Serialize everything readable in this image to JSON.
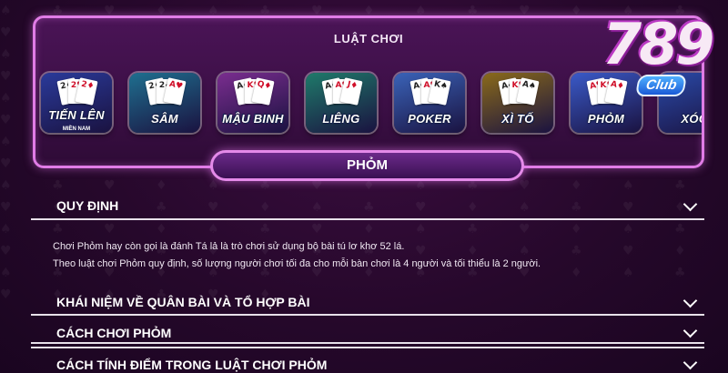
{
  "panel": {
    "title": "LUẬT CHƠI"
  },
  "games": [
    {
      "label": "TIẾN LÊN",
      "sub": "MIỀN NAM",
      "bg": "#2a3a9a",
      "c1": "2♠",
      "c2": "2♥",
      "c3": "2♦"
    },
    {
      "label": "SÂM",
      "bg": "#1f6f8f",
      "c1": "2♠",
      "c2": "2♣",
      "c3": "A♥"
    },
    {
      "label": "MẬU BINH",
      "bg": "#7a2d8f",
      "c1": "A♠",
      "c2": "K♥",
      "c3": "Q♦"
    },
    {
      "label": "LIÊNG",
      "bg": "#1f7a6a",
      "c1": "A♠",
      "c2": "A♥",
      "c3": "J♦"
    },
    {
      "label": "POKER",
      "bg": "#3a63b8",
      "c1": "A♠",
      "c2": "A♥",
      "c3": "K♠"
    },
    {
      "label": "XÌ TỐ",
      "bg": "#8a6a1a",
      "c1": "A♣",
      "c2": "K♥",
      "c3": "A♠"
    },
    {
      "label": "PHỎM",
      "bg": "#3a5ac8",
      "c1": "A♥",
      "c2": "K♥",
      "c3": "A♦"
    },
    {
      "label": "XÓC",
      "bg": "#2a4aa8",
      "c1": "",
      "c2": "",
      "c3": ""
    }
  ],
  "logo": {
    "number": "789",
    "club": "Club"
  },
  "selected_game": "PHỎM",
  "sections": [
    {
      "title": "QUY ĐỊNH"
    },
    {
      "title": "KHÁI NIỆM VỀ QUÂN BÀI VÀ TỔ HỢP BÀI"
    },
    {
      "title": "CÁCH CHƠI PHỎM"
    },
    {
      "title": "CÁCH TÍNH ĐIỂM TRONG LUẬT CHƠI PHỎM"
    }
  ],
  "quy_dinh_content": [
    "Chơi Phỏm hay còn gọi là đánh Tá lả là trò chơi sử dụng bộ bài tú lơ khơ 52 lá.",
    "Theo luật chơi Phỏm quy định, số lượng người chơi tối đa cho mỗi bàn chơi là 4 người và tối thiểu là 2 người."
  ]
}
